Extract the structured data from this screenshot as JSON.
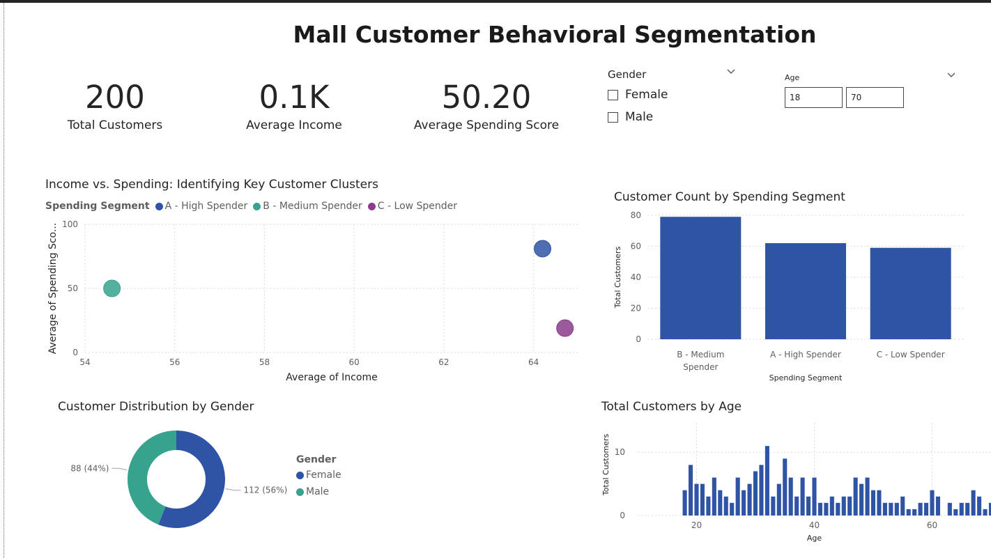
{
  "page": {
    "title": "Mall Customer Behavioral Segmentation"
  },
  "kpis": [
    {
      "value": "200",
      "label": "Total Customers"
    },
    {
      "value": "0.1K",
      "label": "Average Income"
    },
    {
      "value": "50.20",
      "label": "Average Spending Score"
    }
  ],
  "slicers": {
    "gender": {
      "title": "Gender",
      "options": [
        {
          "label": "Female",
          "checked": false
        },
        {
          "label": "Male",
          "checked": false
        }
      ]
    },
    "age": {
      "title": "Age",
      "min_value": "18",
      "max_value": "70"
    }
  },
  "colors": {
    "high": "#2f54a6",
    "medium": "#37a38e",
    "low": "#8b3c8b",
    "bar": "#2f54a6"
  },
  "chart_data": [
    {
      "id": "scatter",
      "type": "scatter",
      "title": "Income vs. Spending: Identifying Key Customer Clusters",
      "legend_title": "Spending Segment",
      "xlabel": "Average of Income",
      "ylabel": "Average of Spending Sco...",
      "xlim": [
        54,
        65
      ],
      "ylim": [
        0,
        100
      ],
      "xticks": [
        54,
        56,
        58,
        60,
        62,
        64
      ],
      "yticks": [
        0,
        50,
        100
      ],
      "series": [
        {
          "name": "A - High Spender",
          "color": "#2f54a6",
          "points": [
            {
              "x": 64.2,
              "y": 81
            }
          ]
        },
        {
          "name": "B - Medium Spender",
          "color": "#37a38e",
          "points": [
            {
              "x": 54.6,
              "y": 50
            }
          ]
        },
        {
          "name": "C - Low Spender",
          "color": "#8b3c8b",
          "points": [
            {
              "x": 64.7,
              "y": 19
            }
          ]
        }
      ]
    },
    {
      "id": "segment_bar",
      "type": "bar",
      "title": "Customer Count by Spending Segment",
      "xlabel": "Spending Segment",
      "ylabel": "Total Customers",
      "ylim": [
        0,
        80
      ],
      "yticks": [
        0,
        20,
        40,
        60,
        80
      ],
      "categories": [
        [
          "B - Medium",
          "Spender"
        ],
        [
          "A - High Spender"
        ],
        [
          "C - Low Spender"
        ]
      ],
      "values": [
        79,
        62,
        59
      ]
    },
    {
      "id": "gender_donut",
      "type": "pie",
      "title": "Customer Distribution by Gender",
      "legend_title": "Gender",
      "slices": [
        {
          "name": "Female",
          "value": 112,
          "label": "112 (56%)",
          "color": "#2f54a6"
        },
        {
          "name": "Male",
          "value": 88,
          "label": "88 (44%)",
          "color": "#37a38e"
        }
      ]
    },
    {
      "id": "age_bar",
      "type": "bar",
      "title": "Total Customers by Age",
      "xlabel": "Age",
      "ylabel": "Total Customers",
      "xlim": [
        10,
        70
      ],
      "ylim": [
        0,
        13
      ],
      "xticks": [
        20,
        40,
        60
      ],
      "yticks": [
        0,
        10
      ],
      "x": [
        18,
        19,
        20,
        21,
        22,
        23,
        24,
        25,
        26,
        27,
        28,
        29,
        30,
        31,
        32,
        33,
        34,
        35,
        36,
        37,
        38,
        39,
        40,
        41,
        42,
        43,
        44,
        45,
        46,
        47,
        48,
        49,
        50,
        51,
        52,
        53,
        54,
        55,
        56,
        57,
        58,
        59,
        60,
        61,
        62,
        63,
        64,
        65,
        66,
        67,
        68,
        69,
        70
      ],
      "values": [
        4,
        8,
        5,
        5,
        3,
        6,
        4,
        3,
        2,
        6,
        4,
        5,
        7,
        8,
        11,
        3,
        5,
        9,
        6,
        3,
        6,
        3,
        6,
        2,
        2,
        3,
        2,
        3,
        3,
        6,
        5,
        6,
        4,
        4,
        2,
        2,
        2,
        3,
        1,
        1,
        2,
        2,
        4,
        3,
        0,
        2,
        1,
        2,
        2,
        4,
        3,
        1,
        2
      ]
    }
  ]
}
